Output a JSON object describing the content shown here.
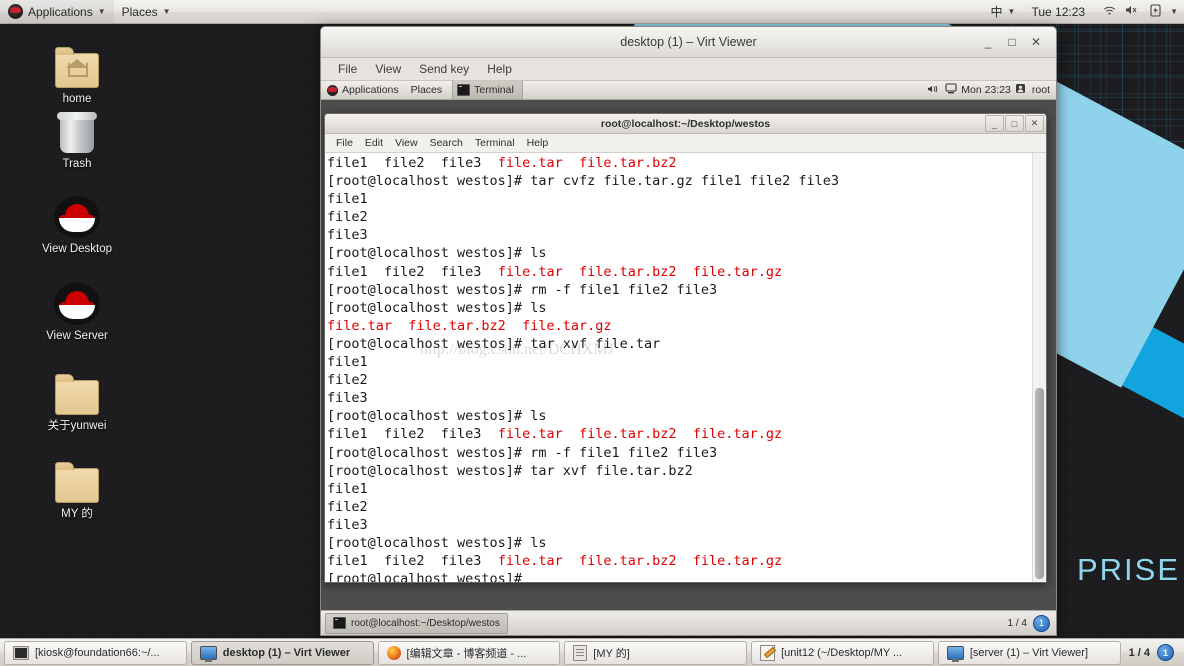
{
  "host_panel": {
    "applications": "Applications",
    "places": "Places",
    "input_method": "中",
    "clock": "Tue 12:23",
    "icons": [
      "redhat-logo",
      "caret-down",
      "wifi-icon",
      "volume-muted-icon",
      "battery-icon",
      "caret-down"
    ]
  },
  "desktop_icons": [
    {
      "label": "home",
      "icon": "home-folder-icon"
    },
    {
      "label": "Trash",
      "icon": "trash-icon"
    },
    {
      "label": "View Desktop",
      "icon": "redhat-icon"
    },
    {
      "label": "View Server",
      "icon": "redhat-icon"
    },
    {
      "label": "关于yunwei",
      "icon": "folder-icon"
    },
    {
      "label": "MY 的",
      "icon": "folder-icon"
    }
  ],
  "wallpaper": {
    "word": "PRISE",
    "accent_light": "#8ed2ec",
    "accent_dark": "#11a4de",
    "background": "#1b1b1d"
  },
  "virt_viewer": {
    "title": "desktop (1) – Virt Viewer",
    "menus": [
      "File",
      "View",
      "Send key",
      "Help"
    ],
    "window_buttons": {
      "minimize": "_",
      "maximize": "□",
      "close": "✕"
    }
  },
  "guest_panel": {
    "applications": "Applications",
    "places": "Places",
    "task": "Terminal",
    "clock": "Mon 23:23",
    "user": "root",
    "icons": [
      "volume-icon",
      "network-icon",
      "user-icon"
    ]
  },
  "terminal": {
    "title": "root@localhost:~/Desktop/westos",
    "menus": [
      "File",
      "Edit",
      "View",
      "Search",
      "Terminal",
      "Help"
    ],
    "window_buttons": {
      "minimize": "_",
      "maximize": "□",
      "close": "✕"
    },
    "watermark": "http://blog.csdn.net/DCHXMJ",
    "colors": {
      "text": "#1a1a1a",
      "archive": "#e00000",
      "background": "#ffffff"
    },
    "lines": [
      [
        {
          "t": "file1  file2  file3  ",
          "c": "n"
        },
        {
          "t": "file.tar  file.tar.bz2",
          "c": "r"
        }
      ],
      [
        {
          "t": "[root@localhost westos]# tar cvfz file.tar.gz file1 file2 file3",
          "c": "n"
        }
      ],
      [
        {
          "t": "file1",
          "c": "n"
        }
      ],
      [
        {
          "t": "file2",
          "c": "n"
        }
      ],
      [
        {
          "t": "file3",
          "c": "n"
        }
      ],
      [
        {
          "t": "[root@localhost westos]# ls",
          "c": "n"
        }
      ],
      [
        {
          "t": "file1  file2  file3  ",
          "c": "n"
        },
        {
          "t": "file.tar  file.tar.bz2  file.tar.gz",
          "c": "r"
        }
      ],
      [
        {
          "t": "[root@localhost westos]# rm -f file1 file2 file3",
          "c": "n"
        }
      ],
      [
        {
          "t": "[root@localhost westos]# ls",
          "c": "n"
        }
      ],
      [
        {
          "t": "file.tar  file.tar.bz2  file.tar.gz",
          "c": "r"
        }
      ],
      [
        {
          "t": "[root@localhost westos]# tar xvf file.tar",
          "c": "n"
        }
      ],
      [
        {
          "t": "file1",
          "c": "n"
        }
      ],
      [
        {
          "t": "file2",
          "c": "n"
        }
      ],
      [
        {
          "t": "file3",
          "c": "n"
        }
      ],
      [
        {
          "t": "[root@localhost westos]# ls",
          "c": "n"
        }
      ],
      [
        {
          "t": "file1  file2  file3  ",
          "c": "n"
        },
        {
          "t": "file.tar  file.tar.bz2  file.tar.gz",
          "c": "r"
        }
      ],
      [
        {
          "t": "[root@localhost westos]# rm -f file1 file2 file3",
          "c": "n"
        }
      ],
      [
        {
          "t": "[root@localhost westos]# tar xvf file.tar.bz2",
          "c": "n"
        }
      ],
      [
        {
          "t": "file1",
          "c": "n"
        }
      ],
      [
        {
          "t": "file2",
          "c": "n"
        }
      ],
      [
        {
          "t": "file3",
          "c": "n"
        }
      ],
      [
        {
          "t": "[root@localhost westos]# ls",
          "c": "n"
        }
      ],
      [
        {
          "t": "file1  file2  file3  ",
          "c": "n"
        },
        {
          "t": "file.tar  file.tar.bz2  file.tar.gz",
          "c": "r"
        }
      ],
      [
        {
          "t": "[root@localhost westos]#",
          "c": "n"
        }
      ]
    ]
  },
  "guest_taskbar": {
    "window_button": "root@localhost:~/Desktop/westos",
    "workspace_label": "1 / 4",
    "workspace_badge": "1"
  },
  "host_taskbar": {
    "buttons": [
      {
        "label": "[kiosk@foundation66:~/...",
        "icon": "terminal-icon",
        "active": false
      },
      {
        "label": "desktop (1) – Virt Viewer",
        "icon": "monitor-icon",
        "active": true
      },
      {
        "label": "[编辑文章 - 博客频道 - ...",
        "icon": "firefox-icon",
        "active": false
      },
      {
        "label": "[MY 的]",
        "icon": "file-manager-icon",
        "active": false
      },
      {
        "label": "[unit12 (~/Desktop/MY ...",
        "icon": "text-editor-icon",
        "active": false
      },
      {
        "label": "[server (1) – Virt Viewer]",
        "icon": "monitor-icon",
        "active": false
      }
    ],
    "workspace_label": "1 / 4",
    "workspace_badge": "1"
  }
}
